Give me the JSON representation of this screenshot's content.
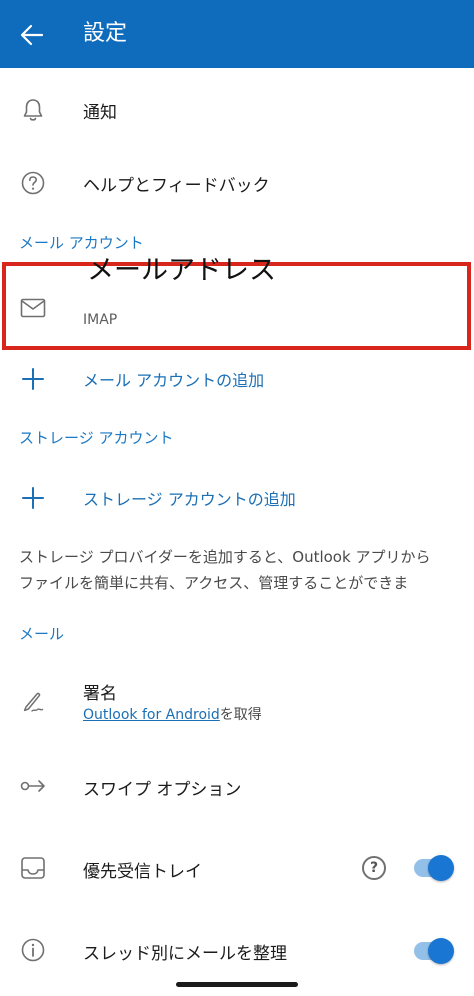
{
  "header": {
    "title": "設定",
    "back_icon": "arrow-left-icon"
  },
  "top_items": [
    {
      "label": "通知",
      "icon": "bell-icon"
    },
    {
      "label": "ヘルプとフィードバック",
      "icon": "help-circle-icon"
    }
  ],
  "mail_accounts": {
    "section_title": "メール アカウント",
    "account": {
      "name": "メールアドレス",
      "type": "IMAP",
      "icon": "mail-icon"
    },
    "add_label": "メール アカウントの追加"
  },
  "storage_accounts": {
    "section_title": "ストレージ アカウント",
    "add_label": "ストレージ アカウントの追加",
    "description_line1": "ストレージ プロバイダーを追加すると、Outlook アプリから",
    "description_line2": "ファイルを簡単に共有、アクセス、管理することができま"
  },
  "mail": {
    "section_title": "メール",
    "signature": {
      "label": "署名",
      "link": "Outlook for Android",
      "link_suffix": "を取得",
      "icon": "signature-icon"
    },
    "swipe": {
      "label": "スワイプ オプション",
      "icon": "swipe-icon"
    },
    "focused_inbox": {
      "label": "優先受信トレイ",
      "icon": "inbox-icon",
      "help_glyph": "?",
      "enabled": true
    },
    "threading": {
      "label": "スレッド別にメールを整理",
      "icon": "info-icon",
      "enabled": true
    }
  },
  "colors": {
    "accent": "#0f6cbd",
    "highlight_border": "#d9261c",
    "toggle_on": "#1976d2"
  }
}
